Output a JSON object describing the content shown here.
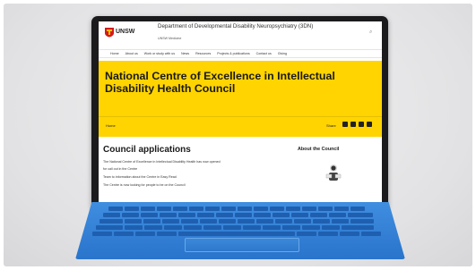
{
  "site": {
    "brand": "UNSW",
    "department": "Department of Developmental Disability Neuropsychiatry (3DN)",
    "subline": "UNSW Medicine",
    "nav": [
      "Home",
      "About us",
      "Work or study with us",
      "News",
      "Resources",
      "Projects & publications",
      "Contact us",
      "Giving"
    ],
    "banner_title": "National Centre of Excellence in Intellectual Disability Health Council",
    "breadcrumb": "Home",
    "share_label": "Share"
  },
  "content": {
    "heading": "Council applications",
    "lines": [
      "The National Centre of Excellence in Intellectual Disability Health has now opened",
      "for call out in the Centre",
      "Team to information about the Centre in Easy Read",
      "The Centre is now looking for people to be on the Council"
    ],
    "aside_title": "About the Council"
  },
  "colors": {
    "banner": "#ffd400",
    "keyboard": "#2f7bd1",
    "bezel": "#1b1b1d"
  }
}
